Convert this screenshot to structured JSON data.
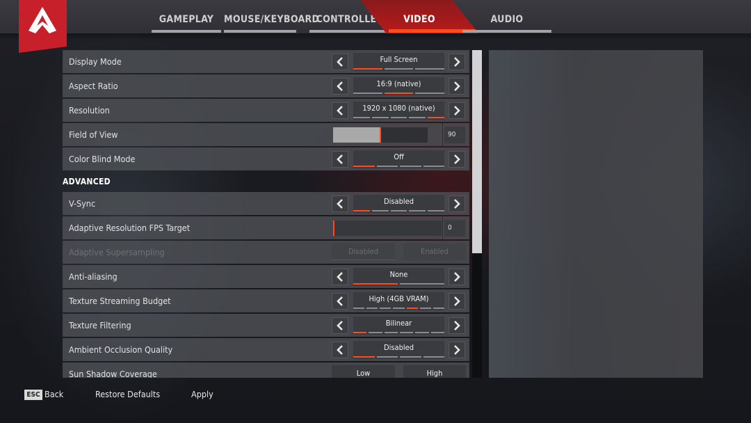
{
  "tabs": [
    {
      "label": "GAMEPLAY",
      "active": false
    },
    {
      "label": "MOUSE/KEYBOARD",
      "active": false
    },
    {
      "label": "CONTROLLER",
      "active": false
    },
    {
      "label": "VIDEO",
      "active": true
    },
    {
      "label": "AUDIO",
      "active": false
    }
  ],
  "colors": {
    "accent": "#ff4b1f",
    "logo_red": "#c8202a",
    "active_tab": "#b81a1a"
  },
  "settings": [
    {
      "label": "Display Mode",
      "type": "selector",
      "value": "Full Screen",
      "options_count": 3,
      "selected_index": 0
    },
    {
      "label": "Aspect Ratio",
      "type": "selector",
      "value": "16:9 (native)",
      "options_count": 3,
      "selected_index": 1
    },
    {
      "label": "Resolution",
      "type": "selector",
      "value": "1920 x 1080 (native)",
      "options_count": 5,
      "selected_index": 4
    },
    {
      "label": "Field of View",
      "type": "slider",
      "value": "90",
      "fraction": 0.5
    },
    {
      "label": "Color Blind Mode",
      "type": "selector",
      "value": "Off",
      "options_count": 4,
      "selected_index": 0
    }
  ],
  "advanced_heading": "ADVANCED",
  "advanced": [
    {
      "label": "V-Sync",
      "type": "selector",
      "value": "Disabled",
      "options_count": 5,
      "selected_index": 0
    },
    {
      "label": "Adaptive Resolution FPS Target",
      "type": "slider",
      "value": "0",
      "fraction": 0.0
    },
    {
      "label": "Adaptive Supersampling",
      "type": "toggle",
      "disabled": true,
      "options": [
        "Disabled",
        "Enabled"
      ]
    },
    {
      "label": "Anti-aliasing",
      "type": "selector",
      "value": "None",
      "options_count": 2,
      "selected_index": 0
    },
    {
      "label": "Texture Streaming Budget",
      "type": "selector",
      "value": "High (4GB VRAM)",
      "options_count": 7,
      "selected_index": 4
    },
    {
      "label": "Texture Filtering",
      "type": "selector",
      "value": "Bilinear",
      "options_count": 6,
      "selected_index": 0
    },
    {
      "label": "Ambient Occlusion Quality",
      "type": "selector",
      "value": "Disabled",
      "options_count": 4,
      "selected_index": 0
    },
    {
      "label": "Sun Shadow Coverage",
      "type": "toggle",
      "disabled": false,
      "options": [
        "Low",
        "High"
      ]
    }
  ],
  "scroll": {
    "fraction_visible": 0.62,
    "position": 0.0
  },
  "footer": {
    "esc_key": "ESC",
    "back_label": "Back",
    "restore_label": "Restore Defaults",
    "apply_label": "Apply"
  },
  "icons": {
    "logo": "apex-logo-icon",
    "left": "chevron-left-icon",
    "right": "chevron-right-icon"
  }
}
